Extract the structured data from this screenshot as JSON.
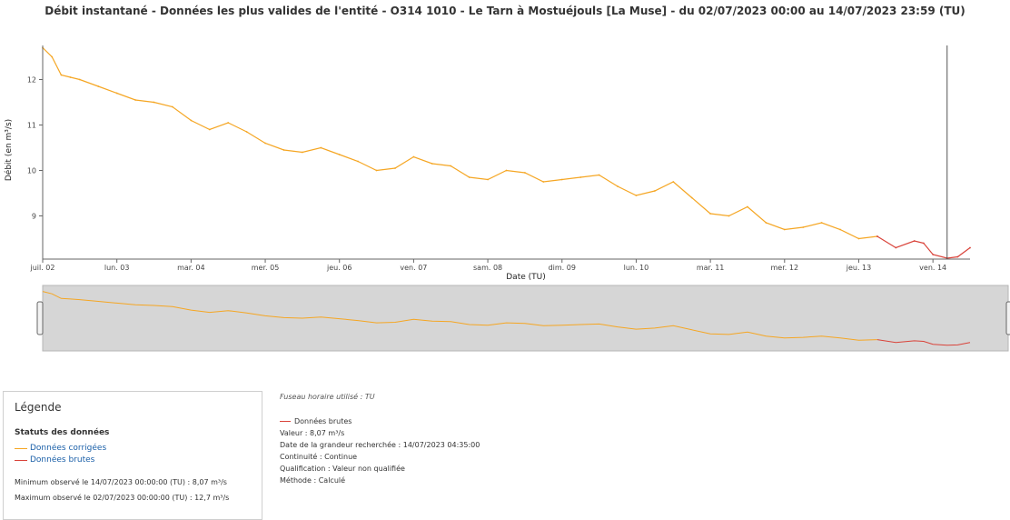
{
  "chart_data": {
    "type": "line",
    "title": "Débit instantané - Données les plus valides de l'entité - O314 1010 - Le Tarn à Mostuéjouls [La Muse] - du 02/07/2023 00:00 au 14/07/2023 23:59 (TU)",
    "xlabel": "Date (TU)",
    "ylabel": "Débit (en m³/s)",
    "x_ticks": [
      "juil. 02",
      "lun. 03",
      "mar. 04",
      "mer. 05",
      "jeu. 06",
      "ven. 07",
      "sam. 08",
      "dim. 09",
      "lun. 10",
      "mar. 11",
      "mer. 12",
      "jeu. 13",
      "ven. 14"
    ],
    "y_ticks": [
      "9",
      "10",
      "11",
      "12"
    ],
    "ylim": [
      8.05,
      12.75
    ],
    "xlim": [
      "2023-07-02T00:00",
      "2023-07-14T12:00"
    ],
    "grid": false,
    "series": [
      {
        "name": "Données corrigées",
        "color": "#f5a623",
        "x": [
          "2023-07-02T00:00",
          "2023-07-02T03:00",
          "2023-07-02T06:00",
          "2023-07-02T09:00",
          "2023-07-02T12:00",
          "2023-07-02T18:00",
          "2023-07-03T00:00",
          "2023-07-03T06:00",
          "2023-07-03T12:00",
          "2023-07-03T18:00",
          "2023-07-04T00:00",
          "2023-07-04T06:00",
          "2023-07-04T12:00",
          "2023-07-04T18:00",
          "2023-07-05T00:00",
          "2023-07-05T06:00",
          "2023-07-05T12:00",
          "2023-07-05T18:00",
          "2023-07-06T00:00",
          "2023-07-06T06:00",
          "2023-07-06T12:00",
          "2023-07-06T18:00",
          "2023-07-07T00:00",
          "2023-07-07T06:00",
          "2023-07-07T12:00",
          "2023-07-07T18:00",
          "2023-07-08T00:00",
          "2023-07-08T06:00",
          "2023-07-08T12:00",
          "2023-07-08T18:00",
          "2023-07-09T00:00",
          "2023-07-09T06:00",
          "2023-07-09T12:00",
          "2023-07-09T18:00",
          "2023-07-10T00:00",
          "2023-07-10T06:00",
          "2023-07-10T12:00",
          "2023-07-10T18:00",
          "2023-07-11T00:00",
          "2023-07-11T06:00",
          "2023-07-11T12:00",
          "2023-07-11T18:00",
          "2023-07-12T00:00",
          "2023-07-12T06:00",
          "2023-07-12T12:00",
          "2023-07-12T18:00",
          "2023-07-13T00:00",
          "2023-07-13T06:00"
        ],
        "values": [
          12.7,
          12.5,
          12.1,
          12.05,
          12.0,
          11.85,
          11.7,
          11.55,
          11.5,
          11.4,
          11.1,
          10.9,
          11.05,
          10.85,
          10.6,
          10.45,
          10.4,
          10.5,
          10.35,
          10.2,
          10.0,
          10.05,
          10.3,
          10.15,
          10.1,
          9.85,
          9.8,
          10.0,
          9.95,
          9.75,
          9.8,
          9.85,
          9.9,
          9.65,
          9.45,
          9.55,
          9.75,
          9.4,
          9.05,
          9.0,
          9.2,
          8.85,
          8.7,
          8.75,
          8.85,
          8.7,
          8.5,
          8.55
        ]
      },
      {
        "name": "Données brutes",
        "color": "#d9433a",
        "x": [
          "2023-07-13T06:00",
          "2023-07-13T12:00",
          "2023-07-13T18:00",
          "2023-07-13T21:00",
          "2023-07-14T00:00",
          "2023-07-14T04:35",
          "2023-07-14T08:00",
          "2023-07-14T12:00"
        ],
        "values": [
          8.55,
          8.3,
          8.45,
          8.4,
          8.15,
          8.07,
          8.1,
          8.3
        ]
      }
    ]
  },
  "legend": {
    "title": "Légende",
    "status_title": "Statuts des données",
    "items": [
      {
        "label": "Données corrigées",
        "color": "#f5a623"
      },
      {
        "label": "Données brutes",
        "color": "#d9433a"
      }
    ],
    "min_text": "Minimum observé le 14/07/2023 00:00:00 (TU) : 8,07 m³/s",
    "max_text": "Maximum observé le 02/07/2023 00:00:00 (TU) : 12,7 m³/s"
  },
  "tooltip": {
    "tz_note": "Fuseau horaire utilisé : TU",
    "series_label": "Données brutes",
    "value": "Valeur : 8,07 m³/s",
    "date": "Date de la grandeur recherchée : 14/07/2023 04:35:00",
    "continuity": "Continuité : Continue",
    "qualification": "Qualification : Valeur non qualifiée",
    "method": "Méthode : Calculé"
  },
  "cursor": {
    "x": "2023-07-14T04:35"
  }
}
